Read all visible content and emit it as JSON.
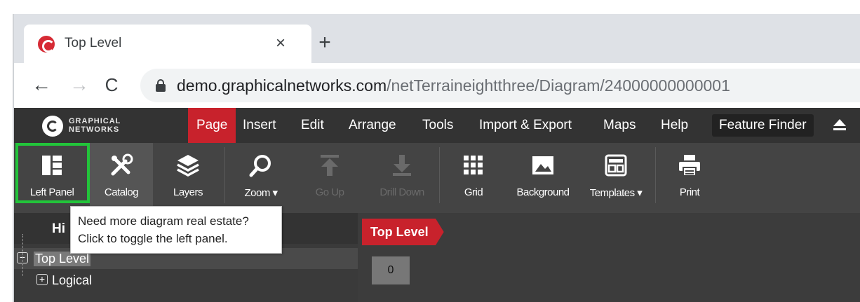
{
  "browser": {
    "tab_title": "Top Level",
    "tab_close": "×",
    "new_tab": "+",
    "back": "←",
    "forward": "→",
    "reload": "C",
    "url_host": "demo.graphicalnetworks.com",
    "url_path": "/netTerraineightthree/Diagram/24000000000001"
  },
  "app": {
    "logo": {
      "line1": "GRAPHICAL",
      "line2": "NETWORKS"
    },
    "menu": [
      "Page",
      "Insert",
      "Edit",
      "Arrange",
      "Tools",
      "Import & Export",
      "Maps",
      "Help"
    ],
    "active_menu": "Page",
    "feature_finder": "Feature Finder",
    "ribbon": {
      "left_panel": "Left Panel",
      "catalog": "Catalog",
      "layers": "Layers",
      "zoom": "Zoom ▾",
      "go_up": "Go Up",
      "drill_down": "Drill Down",
      "grid": "Grid",
      "background": "Background",
      "templates": "Templates ▾",
      "print": "Print"
    },
    "left_panel": {
      "header": "Hi",
      "tree": [
        {
          "label": "Top Level",
          "expander": "−",
          "selected": true
        },
        {
          "label": "Logical",
          "expander": "+",
          "selected": false
        }
      ]
    },
    "canvas": {
      "breadcrumb": "Top Level",
      "count": "0"
    },
    "tooltip": {
      "line1": "Need more diagram real estate?",
      "line2": "Click to toggle the left panel."
    },
    "colors": {
      "accent": "#c8222c",
      "highlight": "#22c43a",
      "menubar": "#333333",
      "ribbon": "#444444"
    }
  }
}
